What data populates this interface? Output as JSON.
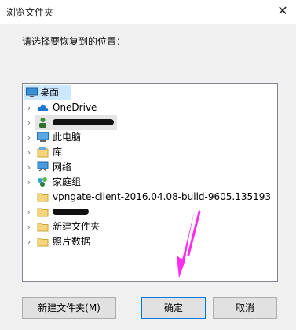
{
  "window": {
    "title": "浏览文件夹",
    "close_glyph": "✕"
  },
  "prompt": "请选择要恢复到的位置：",
  "tree": {
    "items": [
      {
        "label": "桌面",
        "icon": "desktop-icon",
        "expandable": false,
        "level": 0
      },
      {
        "label": "OneDrive",
        "icon": "cloud-icon",
        "expandable": true,
        "level": 1
      },
      {
        "label": "",
        "icon": "user-icon",
        "expandable": true,
        "level": 1,
        "redacted": true
      },
      {
        "label": "此电脑",
        "icon": "computer-icon",
        "expandable": true,
        "level": 1
      },
      {
        "label": "库",
        "icon": "library-icon",
        "expandable": true,
        "level": 1
      },
      {
        "label": "网络",
        "icon": "network-icon",
        "expandable": true,
        "level": 1
      },
      {
        "label": "家庭组",
        "icon": "homegroup-icon",
        "expandable": true,
        "level": 1
      },
      {
        "label": "vpngate-client-2016.04.08-build-9605.135193",
        "icon": "folder-icon",
        "expandable": false,
        "level": 1
      },
      {
        "label": "",
        "icon": "folder-icon",
        "expandable": true,
        "level": 1,
        "redacted": true
      },
      {
        "label": "新建文件夹",
        "icon": "folder-icon",
        "expandable": true,
        "level": 1
      },
      {
        "label": "照片数据",
        "icon": "folder-icon",
        "expandable": true,
        "level": 1
      }
    ]
  },
  "buttons": {
    "new_folder": "新建文件夹(M)",
    "ok": "确定",
    "cancel": "取消"
  },
  "colors": {
    "annotation_arrow": "#ff2cf0",
    "folder": "#f5d47a",
    "selection": "#cce8ff"
  }
}
